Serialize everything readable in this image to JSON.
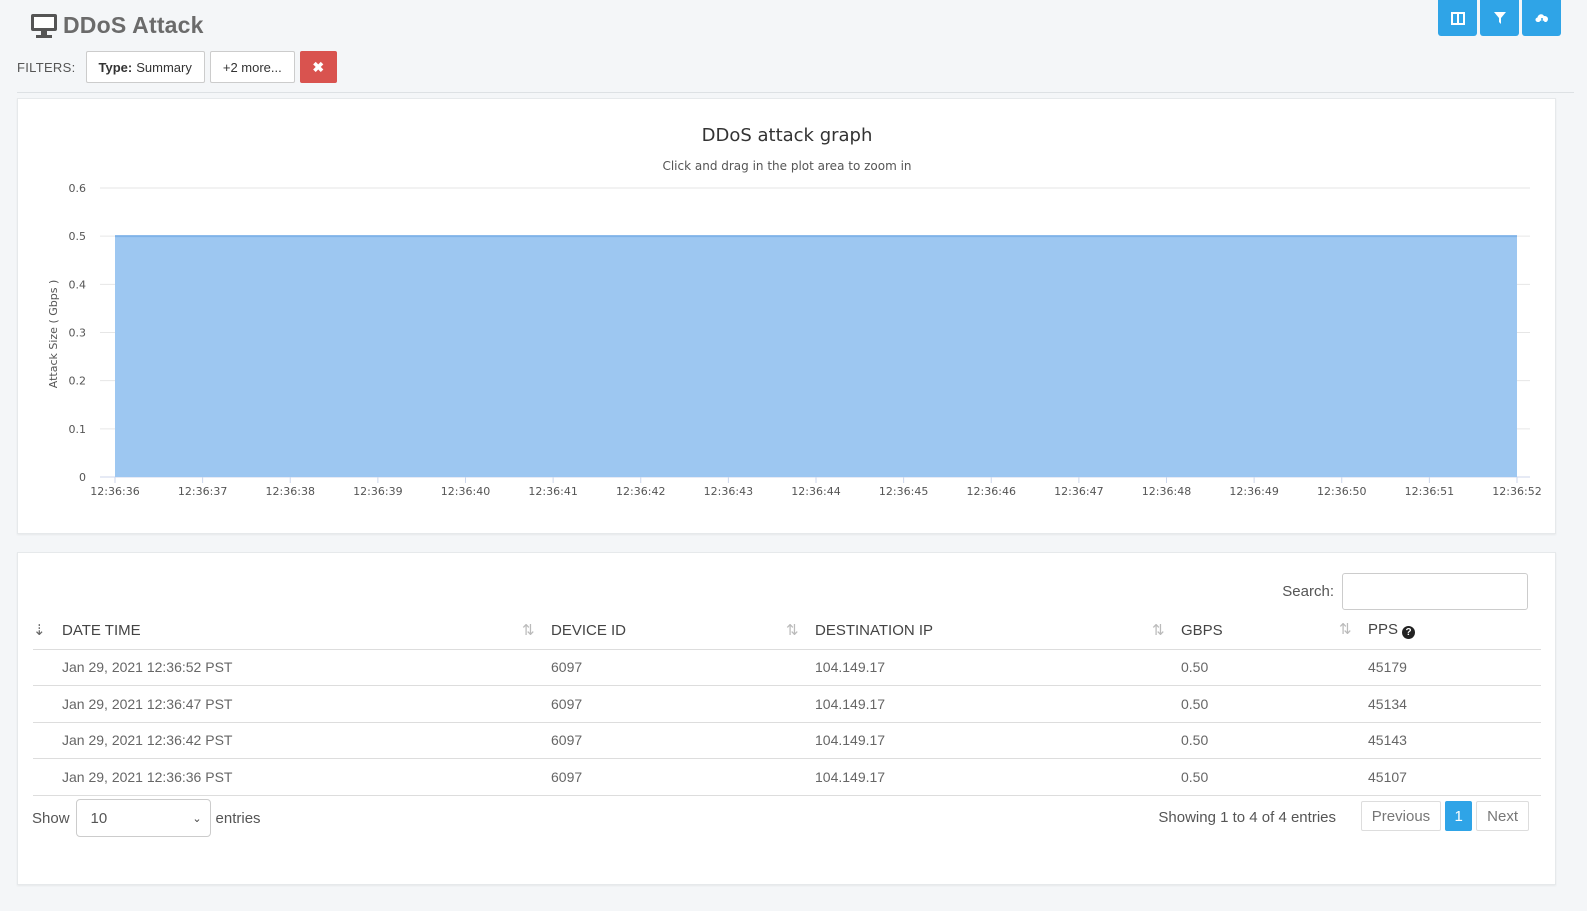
{
  "header": {
    "title": "DDoS Attack"
  },
  "filters": {
    "label": "FILTERS:",
    "type_key": "Type:",
    "type_value": "Summary",
    "more": "+2 more..."
  },
  "toolbar": {
    "icons": [
      "columns-icon",
      "filter-icon",
      "cloud-download-icon"
    ]
  },
  "chart_data": {
    "type": "area",
    "title": "DDoS attack graph",
    "subtitle": "Click and drag in the plot area to zoom in",
    "ylabel": "Attack Size ( Gbps )",
    "xlabel": "",
    "ylim": [
      0,
      0.6
    ],
    "yticks": [
      "0",
      "0.1",
      "0.2",
      "0.3",
      "0.4",
      "0.5",
      "0.6"
    ],
    "x": [
      "12:36:36",
      "12:36:37",
      "12:36:38",
      "12:36:39",
      "12:36:40",
      "12:36:41",
      "12:36:42",
      "12:36:43",
      "12:36:44",
      "12:36:45",
      "12:36:46",
      "12:36:47",
      "12:36:48",
      "12:36:49",
      "12:36:50",
      "12:36:51",
      "12:36:52"
    ],
    "series": [
      {
        "values": [
          0.5,
          0.5,
          0.5,
          0.5,
          0.5,
          0.5,
          0.5,
          0.5,
          0.5,
          0.5,
          0.5,
          0.5,
          0.5,
          0.5,
          0.5,
          0.5,
          0.5
        ],
        "color": "#9dc7f1"
      }
    ],
    "grid": true
  },
  "table": {
    "search_label": "Search:",
    "columns": [
      "DATE TIME",
      "DEVICE ID",
      "DESTINATION IP",
      "GBPS",
      "PPS"
    ],
    "rows": [
      [
        "Jan 29, 2021 12:36:52 PST",
        "6097",
        "104.149.17",
        "0.50",
        "45179"
      ],
      [
        "Jan 29, 2021 12:36:47 PST",
        "6097",
        "104.149.17",
        "0.50",
        "45134"
      ],
      [
        "Jan 29, 2021 12:36:42 PST",
        "6097",
        "104.149.17",
        "0.50",
        "45143"
      ],
      [
        "Jan 29, 2021 12:36:36 PST",
        "6097",
        "104.149.17",
        "0.50",
        "45107"
      ]
    ],
    "show_label": "Show",
    "page_size": "10",
    "entries_label": "entries",
    "info": "Showing 1 to 4 of 4 entries",
    "prev_label": "Previous",
    "current_page": "1",
    "next_label": "Next"
  },
  "colors": {
    "accent": "#2fa4e7",
    "danger": "#d9534f",
    "area_fill": "#9dc7f1"
  }
}
